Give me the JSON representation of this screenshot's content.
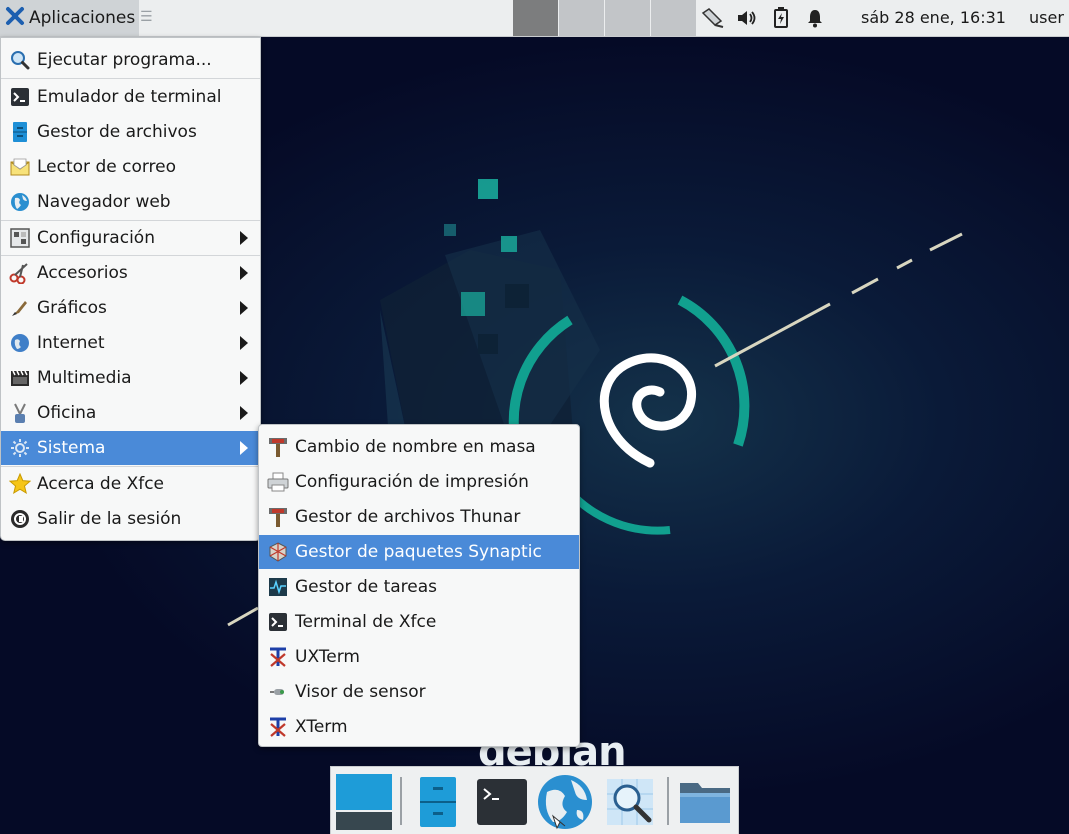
{
  "panel": {
    "apps_label": "Aplicaciones",
    "clock": "sáb 28 ene, 16:31",
    "user": "user",
    "tray_icons": [
      "network-icon",
      "volume-icon",
      "battery-icon",
      "notification-bell-icon"
    ]
  },
  "main_menu": {
    "items": [
      {
        "label": "Ejecutar programa...",
        "icon": "search-icon"
      },
      {
        "label": "Emulador de terminal",
        "icon": "terminal-icon"
      },
      {
        "label": "Gestor de archivos",
        "icon": "file-manager-icon"
      },
      {
        "label": "Lector de correo",
        "icon": "mail-icon"
      },
      {
        "label": "Navegador web",
        "icon": "web-browser-icon"
      },
      {
        "label": "Configuración",
        "icon": "settings-icon"
      },
      {
        "label": "Accesorios",
        "icon": "accessories-icon"
      },
      {
        "label": "Gráficos",
        "icon": "graphics-icon"
      },
      {
        "label": "Internet",
        "icon": "internet-icon"
      },
      {
        "label": "Multimedia",
        "icon": "multimedia-icon"
      },
      {
        "label": "Oficina",
        "icon": "office-icon"
      },
      {
        "label": "Sistema",
        "icon": "system-icon"
      },
      {
        "label": "Acerca de Xfce",
        "icon": "star-icon"
      },
      {
        "label": "Salir de la sesión",
        "icon": "logout-icon"
      }
    ]
  },
  "system_submenu": {
    "items": [
      {
        "label": "Cambio de nombre en masa",
        "icon": "bulk-rename-icon"
      },
      {
        "label": "Configuración de impresión",
        "icon": "printer-icon"
      },
      {
        "label": "Gestor de archivos Thunar",
        "icon": "thunar-icon"
      },
      {
        "label": "Gestor de paquetes Synaptic",
        "icon": "synaptic-icon"
      },
      {
        "label": "Gestor de tareas",
        "icon": "task-manager-icon"
      },
      {
        "label": "Terminal de Xfce",
        "icon": "terminal-icon"
      },
      {
        "label": "UXTerm",
        "icon": "xterm-icon"
      },
      {
        "label": "Visor de sensor",
        "icon": "sensor-icon"
      },
      {
        "label": "XTerm",
        "icon": "xterm-icon"
      }
    ]
  },
  "wallpaper": {
    "wordmark": "debian"
  },
  "dock": {
    "items": [
      "show-desktop-icon",
      "file-manager-icon",
      "terminal-icon",
      "web-browser-icon",
      "app-finder-icon",
      "folder-icon"
    ]
  },
  "colors": {
    "highlight": "#4a8ad8",
    "accent": "#1aa89a",
    "background": "#050a26"
  }
}
